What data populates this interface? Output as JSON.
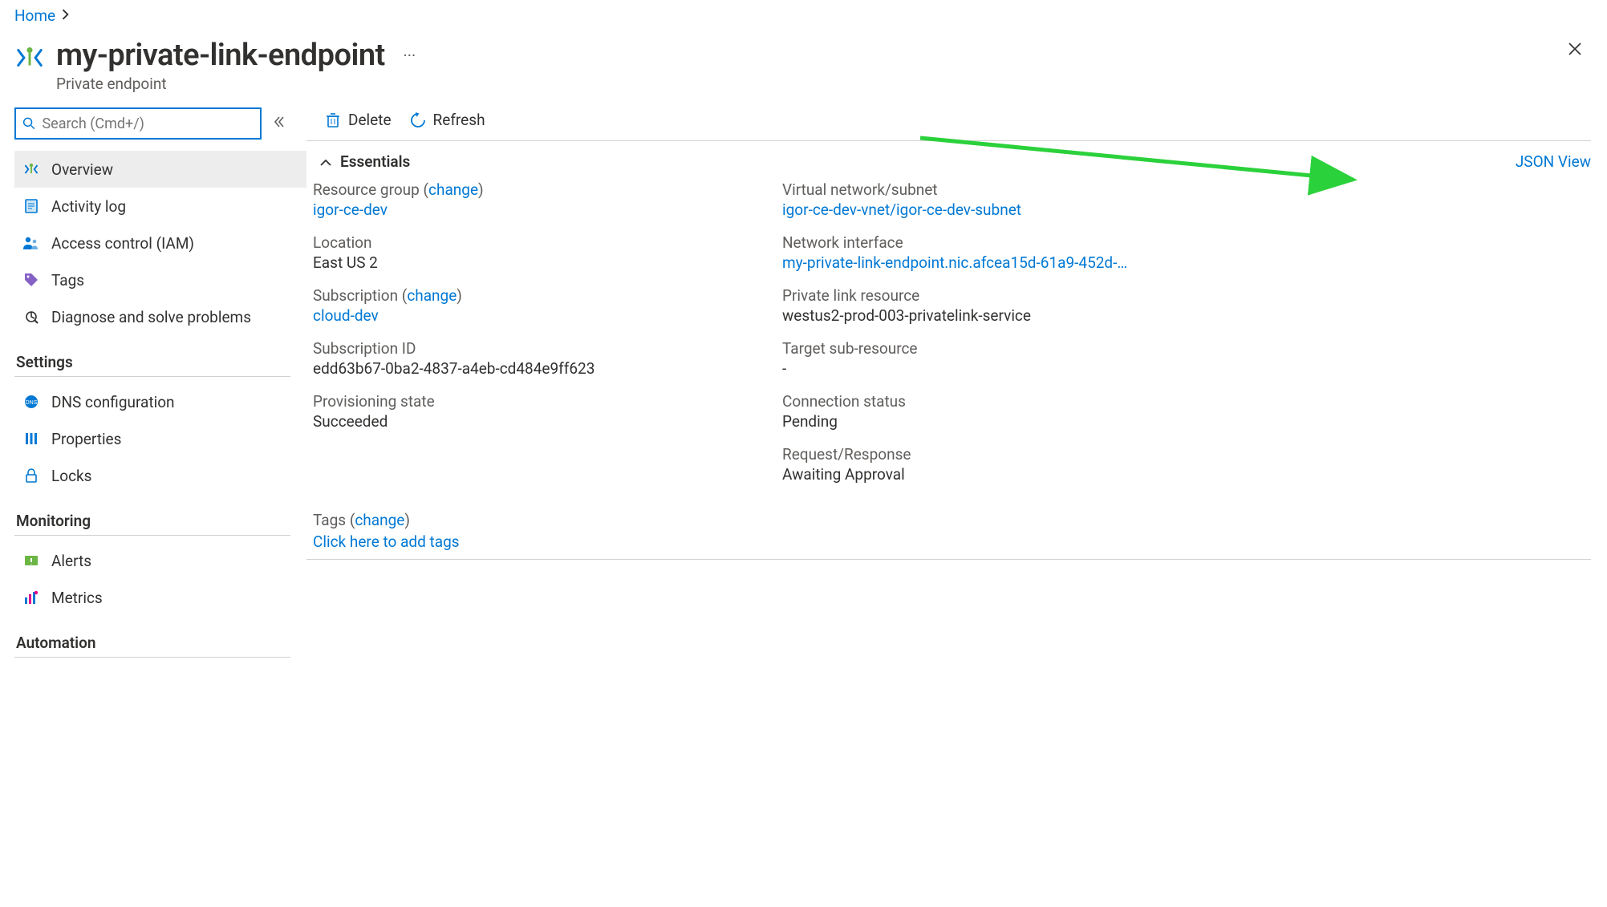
{
  "breadcrumb": {
    "home": "Home"
  },
  "header": {
    "title": "my-private-link-endpoint",
    "subtitle": "Private endpoint"
  },
  "search": {
    "placeholder": "Search (Cmd+/)"
  },
  "nav": {
    "overview": "Overview",
    "activity_log": "Activity log",
    "access_control": "Access control (IAM)",
    "tags": "Tags",
    "diagnose": "Diagnose and solve problems",
    "group_settings": "Settings",
    "dns_config": "DNS configuration",
    "properties": "Properties",
    "locks": "Locks",
    "group_monitoring": "Monitoring",
    "alerts": "Alerts",
    "metrics": "Metrics",
    "group_automation": "Automation"
  },
  "toolbar": {
    "delete": "Delete",
    "refresh": "Refresh"
  },
  "essentials": {
    "header": "Essentials",
    "json_view": "JSON View",
    "change": "change",
    "left": {
      "resource_group_label": "Resource group",
      "resource_group_value": "igor-ce-dev",
      "location_label": "Location",
      "location_value": "East US 2",
      "subscription_label": "Subscription",
      "subscription_value": "cloud-dev",
      "subscription_id_label": "Subscription ID",
      "subscription_id_value": "edd63b67-0ba2-4837-a4eb-cd484e9ff623",
      "provisioning_state_label": "Provisioning state",
      "provisioning_state_value": "Succeeded"
    },
    "right": {
      "vnet_label": "Virtual network/subnet",
      "vnet_value": "igor-ce-dev-vnet/igor-ce-dev-subnet",
      "nic_label": "Network interface",
      "nic_value": "my-private-link-endpoint.nic.afcea15d-61a9-452d-8...",
      "pl_resource_label": "Private link resource",
      "pl_resource_value": "westus2-prod-003-privatelink-service",
      "target_sub_label": "Target sub-resource",
      "target_sub_value": "-",
      "conn_status_label": "Connection status",
      "conn_status_value": "Pending",
      "req_resp_label": "Request/Response",
      "req_resp_value": "Awaiting Approval"
    },
    "tags_label": "Tags",
    "tags_link": "Click here to add tags"
  }
}
